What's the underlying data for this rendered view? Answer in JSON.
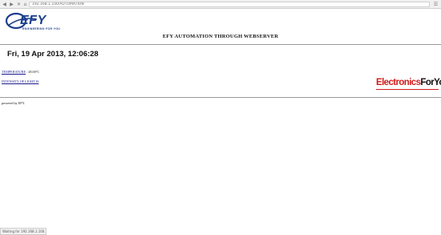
{
  "browser": {
    "url": "192.168.1.100/AUTOMATION",
    "status_text": "Waiting for 192.168.1.100..."
  },
  "header": {
    "logo_text": "EFY",
    "logo_tagline": "ENGINEERING FOR YOU",
    "title": "EFY AUTOMATION THROUGH WEBSERVER"
  },
  "main": {
    "datetime": "Fri, 19 Apr 2013, 12:06:28",
    "temperature_label": "TEMPERATURE",
    "temperature_value": ": 28.00°C",
    "intensity_label": "INTENSITY OF LIGHT IS",
    "brand_left": "Electronics",
    "brand_right": "ForYou"
  },
  "footer": {
    "text": "powered by EFY."
  },
  "colors": {
    "logo_blue": "#1d3f8e",
    "brand_red": "#d01c1c",
    "link_blue": "#1a1a8c"
  }
}
